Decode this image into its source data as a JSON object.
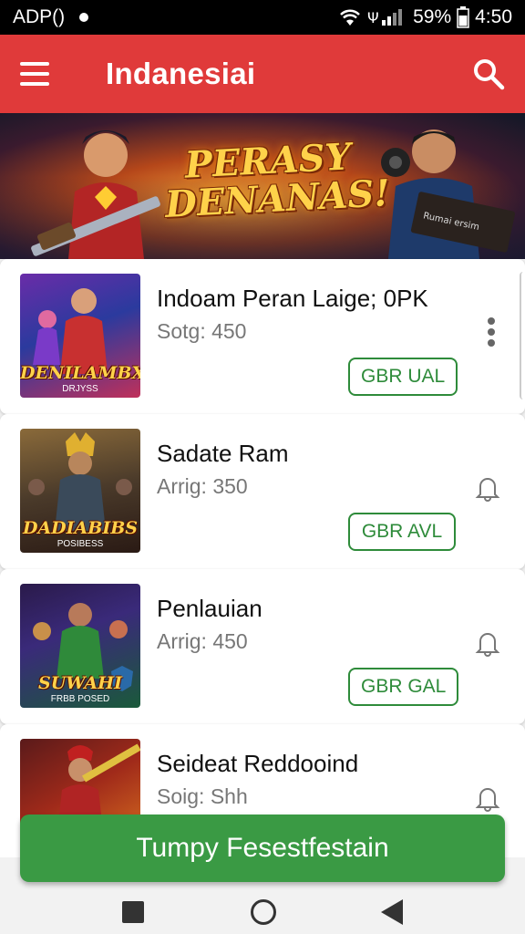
{
  "status_bar": {
    "left_text": "ADP()",
    "battery_text": "59%",
    "time": "4:50"
  },
  "app_bar": {
    "title": "Indanesiai",
    "menu_icon": "menu-icon",
    "search_icon": "search-icon",
    "color": "#e03a3a"
  },
  "banner": {
    "title_line1": "PERASY",
    "title_line2": "DENANAS!",
    "sign_text": "Rumai ersim"
  },
  "items": [
    {
      "title": "Indoam Peran Laige; 0PK",
      "subtitle": "Sotg: 450",
      "button": "GBR UAL",
      "thumb_caption": "DENILAMBX",
      "thumb_sub": "DRJYSS",
      "trailing_icon": "more-vert-icon"
    },
    {
      "title": "Sadate Ram",
      "subtitle": "Arrig: 350",
      "button": "GBR AVL",
      "thumb_caption": "DADIABIBS",
      "thumb_sub": "POSIBESS",
      "trailing_icon": "bell-icon"
    },
    {
      "title": "Penlauian",
      "subtitle": "Arrig: 450",
      "button": "GBR GAL",
      "thumb_caption": "SUWAHI",
      "thumb_sub": "FRBB POSED",
      "trailing_icon": "bell-icon"
    },
    {
      "title": "Seideat Reddooind",
      "subtitle": "Soig: Shh",
      "button": "",
      "thumb_caption": "",
      "thumb_sub": "",
      "trailing_icon": "bell-icon"
    }
  ],
  "cta": {
    "label": "Tumpy Fesestfestain",
    "color": "#3a9a44"
  },
  "accent_green": "#2e8b3a"
}
